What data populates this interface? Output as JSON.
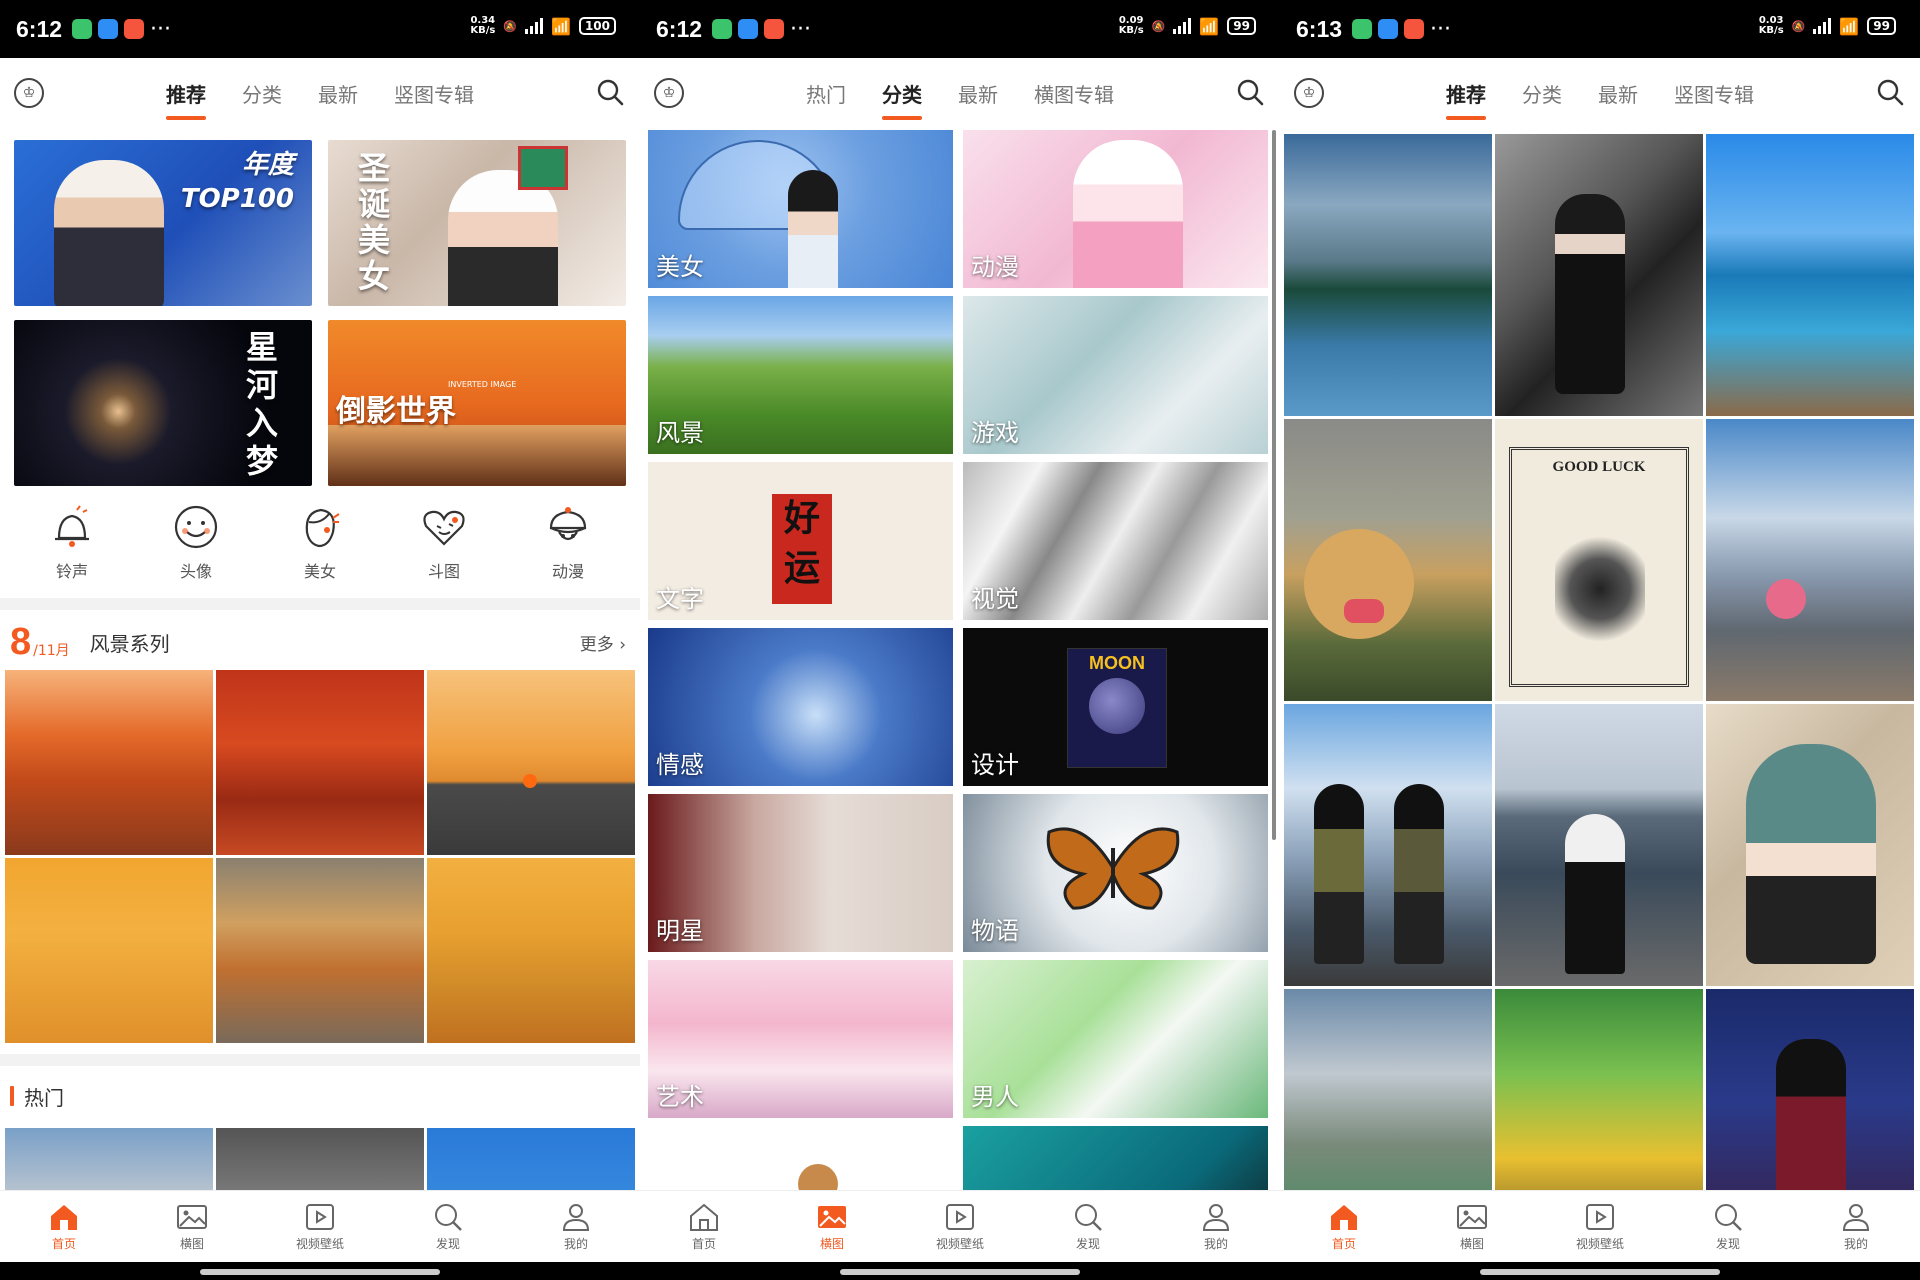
{
  "colors": {
    "accent": "#f25a20",
    "text": "#333333",
    "muted": "#777777"
  },
  "phones": [
    {
      "status": {
        "time": "6:12",
        "speed_top": "0.34",
        "speed_unit": "KB/s",
        "battery": "100"
      },
      "tabs": [
        "推荐",
        "分类",
        "最新",
        "竖图专辑"
      ],
      "active_tab": 0
    },
    {
      "status": {
        "time": "6:12",
        "speed_top": "0.09",
        "speed_unit": "KB/s",
        "battery": "99"
      },
      "tabs": [
        "热门",
        "分类",
        "最新",
        "横图专辑"
      ],
      "active_tab": 1
    },
    {
      "status": {
        "time": "6:13",
        "speed_top": "0.03",
        "speed_unit": "KB/s",
        "battery": "99"
      },
      "tabs": [
        "推荐",
        "分类",
        "最新",
        "竖图专辑"
      ],
      "active_tab": 0
    }
  ],
  "banners": [
    {
      "label": "年度\nTOP100",
      "badge": "hot"
    },
    {
      "label": "圣诞美女"
    },
    {
      "label": "星河入梦"
    },
    {
      "label": "倒影世界",
      "sub": "INVERTED IMAGE"
    }
  ],
  "quick_links": [
    {
      "label": "铃声",
      "icon": "bell-icon"
    },
    {
      "label": "头像",
      "icon": "smile-face-icon"
    },
    {
      "label": "美女",
      "icon": "girl-face-icon"
    },
    {
      "label": "斗图",
      "icon": "heart-face-icon"
    },
    {
      "label": "动漫",
      "icon": "anime-icon"
    }
  ],
  "series": {
    "day": "8",
    "month": "/11月",
    "title": "风景系列",
    "more": "更多 ›"
  },
  "hot": {
    "title": "热门"
  },
  "categories": [
    "美女",
    "动漫",
    "风景",
    "游戏",
    "文字",
    "视觉",
    "情感",
    "设计",
    "明星",
    "物语",
    "艺术",
    "男人"
  ],
  "bottom_nav": [
    {
      "label": "首页",
      "icon": "home-icon"
    },
    {
      "label": "横图",
      "icon": "image-icon"
    },
    {
      "label": "视频壁纸",
      "icon": "video-icon"
    },
    {
      "label": "发现",
      "icon": "discover-icon"
    },
    {
      "label": "我的",
      "icon": "profile-icon"
    }
  ],
  "bottom_nav_active": [
    0,
    1,
    0
  ],
  "poster_texts": {
    "good_luck": "GOOD LUCK",
    "moon": "MOON",
    "hao_yun": "好运"
  }
}
